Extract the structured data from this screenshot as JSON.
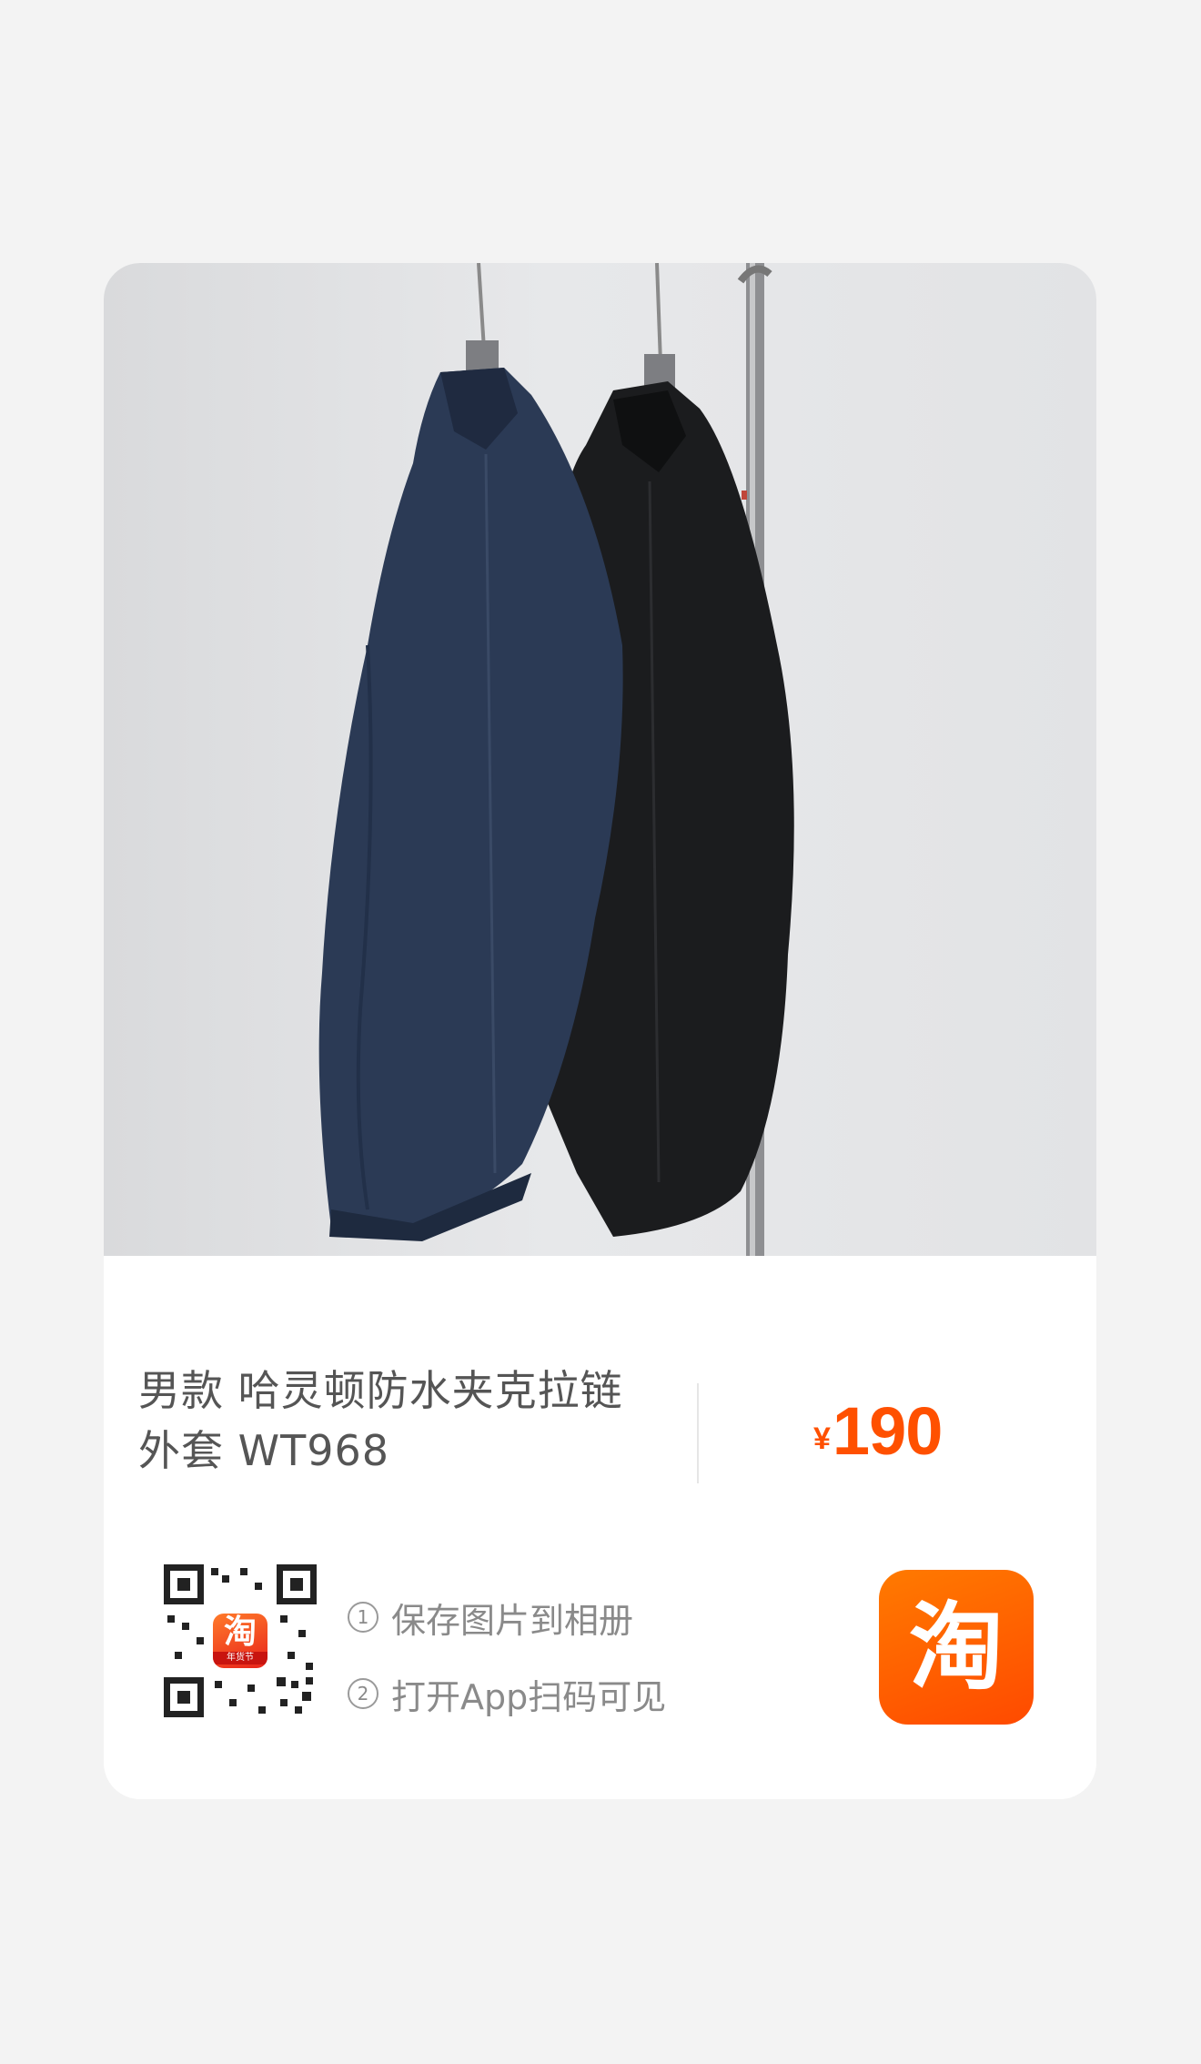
{
  "product": {
    "title_line1": "男款 哈灵顿防水夹克拉链",
    "title_line2": "外套 WT968",
    "price_symbol": "¥",
    "price_value": "190",
    "image_alt": "Two jackets (navy and black) hanging on a rack"
  },
  "share": {
    "qr_logo_glyph": "淘",
    "qr_logo_tag": "年货节",
    "step1_num": "1",
    "step1_text": "保存图片到相册",
    "step2_num": "2",
    "step2_text": "打开App扫码可见"
  },
  "brand": {
    "app_icon_glyph": "淘",
    "accent_color": "#ff5000"
  }
}
